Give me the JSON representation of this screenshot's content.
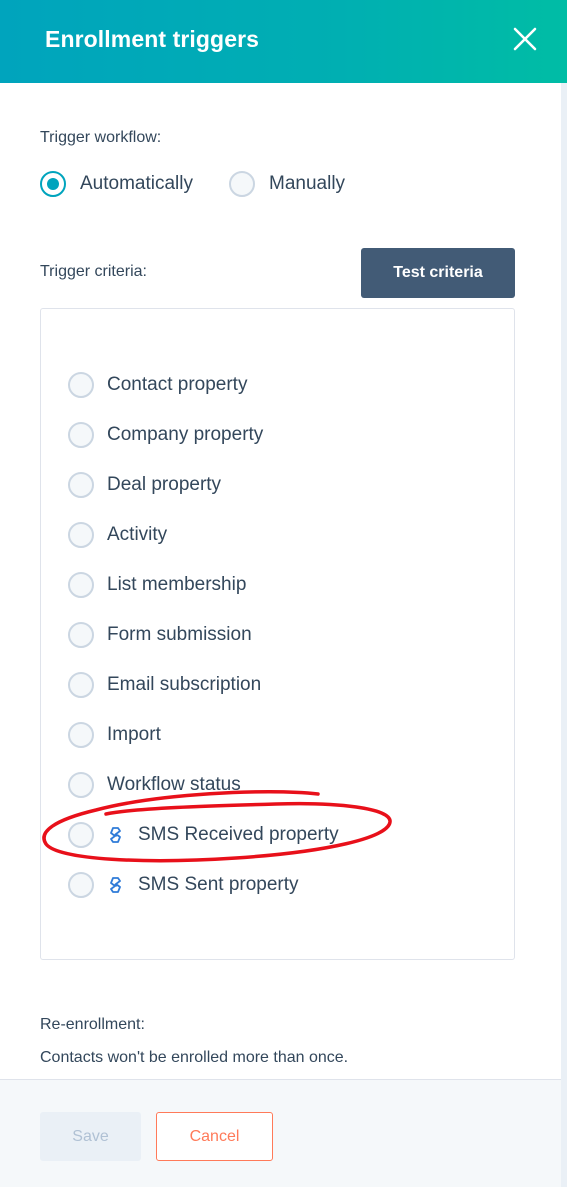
{
  "header": {
    "title": "Enrollment triggers",
    "close_icon": "close-icon"
  },
  "trigger_workflow": {
    "label": "Trigger workflow:",
    "options": [
      {
        "label": "Automatically",
        "selected": true
      },
      {
        "label": "Manually",
        "selected": false
      }
    ]
  },
  "trigger_criteria": {
    "label": "Trigger criteria:",
    "test_button": "Test criteria",
    "options": [
      {
        "label": "Contact property",
        "icon": null
      },
      {
        "label": "Company property",
        "icon": null
      },
      {
        "label": "Deal property",
        "icon": null
      },
      {
        "label": "Activity",
        "icon": null
      },
      {
        "label": "List membership",
        "icon": null
      },
      {
        "label": "Form submission",
        "icon": null
      },
      {
        "label": "Email subscription",
        "icon": null
      },
      {
        "label": "Import",
        "icon": null
      },
      {
        "label": "Workflow status",
        "icon": null
      },
      {
        "label": "SMS Received property",
        "icon": "integration-app-icon"
      },
      {
        "label": "SMS Sent property",
        "icon": "integration-app-icon"
      }
    ]
  },
  "reenrollment": {
    "label": "Re-enrollment:",
    "text": "Contacts won't be enrolled more than once."
  },
  "footer": {
    "save_label": "Save",
    "cancel_label": "Cancel"
  },
  "colors": {
    "header_gradient_start": "#00a4bd",
    "header_gradient_end": "#00bda5",
    "radio_selected": "#00a4bd",
    "test_button_bg": "#425b76",
    "cancel_accent": "#ff7a59",
    "annotation_red": "#e8101a"
  }
}
